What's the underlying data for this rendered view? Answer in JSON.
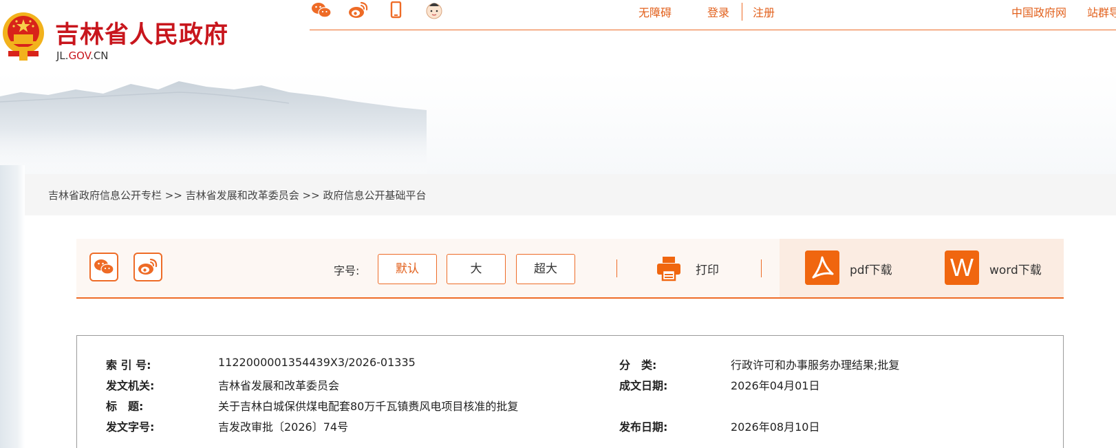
{
  "header": {
    "site_title": "吉林省人民政府",
    "site_domain_prefix": "JL.",
    "site_domain_mid": "GOV",
    "site_domain_suffix": ".CN",
    "social_icons": [
      "wechat-icon",
      "weibo-icon",
      "mobile-icon",
      "kids-icon"
    ],
    "links": {
      "accessibility": "无障碍",
      "login": "登录",
      "register": "注册",
      "gov_cn": "中国政府网",
      "site_group": "站群导航"
    },
    "accent_color": "#ee6b26",
    "title_color": "#c8161d"
  },
  "breadcrumb": {
    "items": [
      "吉林省政府信息公开专栏",
      "吉林省发展和改革委员会",
      "政府信息公开基础平台"
    ],
    "separator": ">>"
  },
  "toolbar": {
    "share_icons": [
      "wechat-icon",
      "weibo-icon"
    ],
    "font_size_label": "字号:",
    "font_sizes": [
      "默认",
      "大",
      "超大"
    ],
    "active_font_size": "默认",
    "print_label": "打印",
    "pdf_label": "pdf下载",
    "word_label": "word下载",
    "word_icon_text": "W"
  },
  "info": {
    "index_no_label": "索 引 号:",
    "index_no": "1122000001354439X3/2026-01335",
    "category_label": "分　类:",
    "category": "行政许可和办事服务办理结果;批复",
    "issuer_label": "发文机关:",
    "issuer": "吉林省发展和改革委员会",
    "date_written_label": "成文日期:",
    "date_written": "2026年04月01日",
    "title_label": "标　题:",
    "title": "关于吉林白城保供煤电配套80万千瓦镇赉风电项目核准的批复",
    "doc_no_label": "发文字号:",
    "doc_no": "吉发改审批〔2026〕74号",
    "publish_date_label": "发布日期:",
    "publish_date": "2026年08月10日"
  }
}
